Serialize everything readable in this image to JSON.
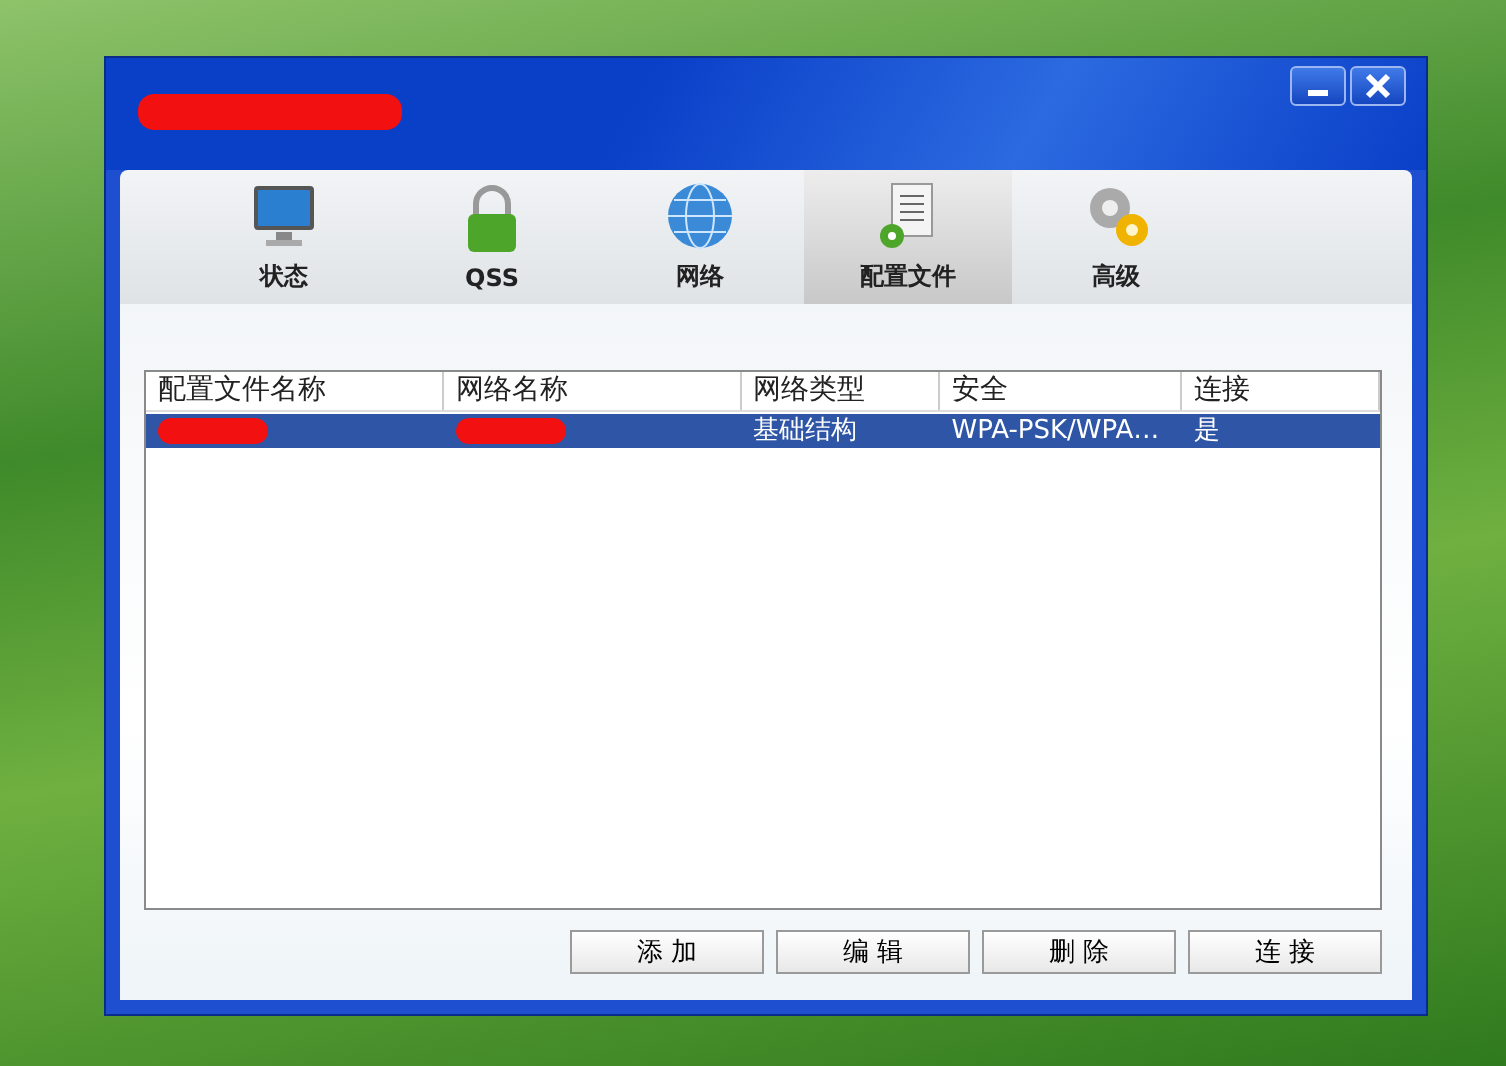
{
  "window": {
    "title_redacted": true
  },
  "tabs": [
    {
      "label": "状态",
      "selected": false
    },
    {
      "label": "QSS",
      "selected": false
    },
    {
      "label": "网络",
      "selected": false
    },
    {
      "label": "配置文件",
      "selected": true
    },
    {
      "label": "高级",
      "selected": false
    }
  ],
  "table": {
    "columns": [
      "配置文件名称",
      "网络名称",
      "网络类型",
      "安全",
      "连接"
    ],
    "rows": [
      {
        "selected": true,
        "cells": [
          {
            "redacted": true
          },
          {
            "redacted": true
          },
          {
            "text": "基础结构",
            "redacted": false
          },
          {
            "text": "WPA-PSK/WPA…",
            "redacted": false
          },
          {
            "text": "是",
            "redacted": false
          }
        ]
      }
    ]
  },
  "buttons": [
    "添 加",
    "编 辑",
    "删 除",
    "连 接"
  ]
}
